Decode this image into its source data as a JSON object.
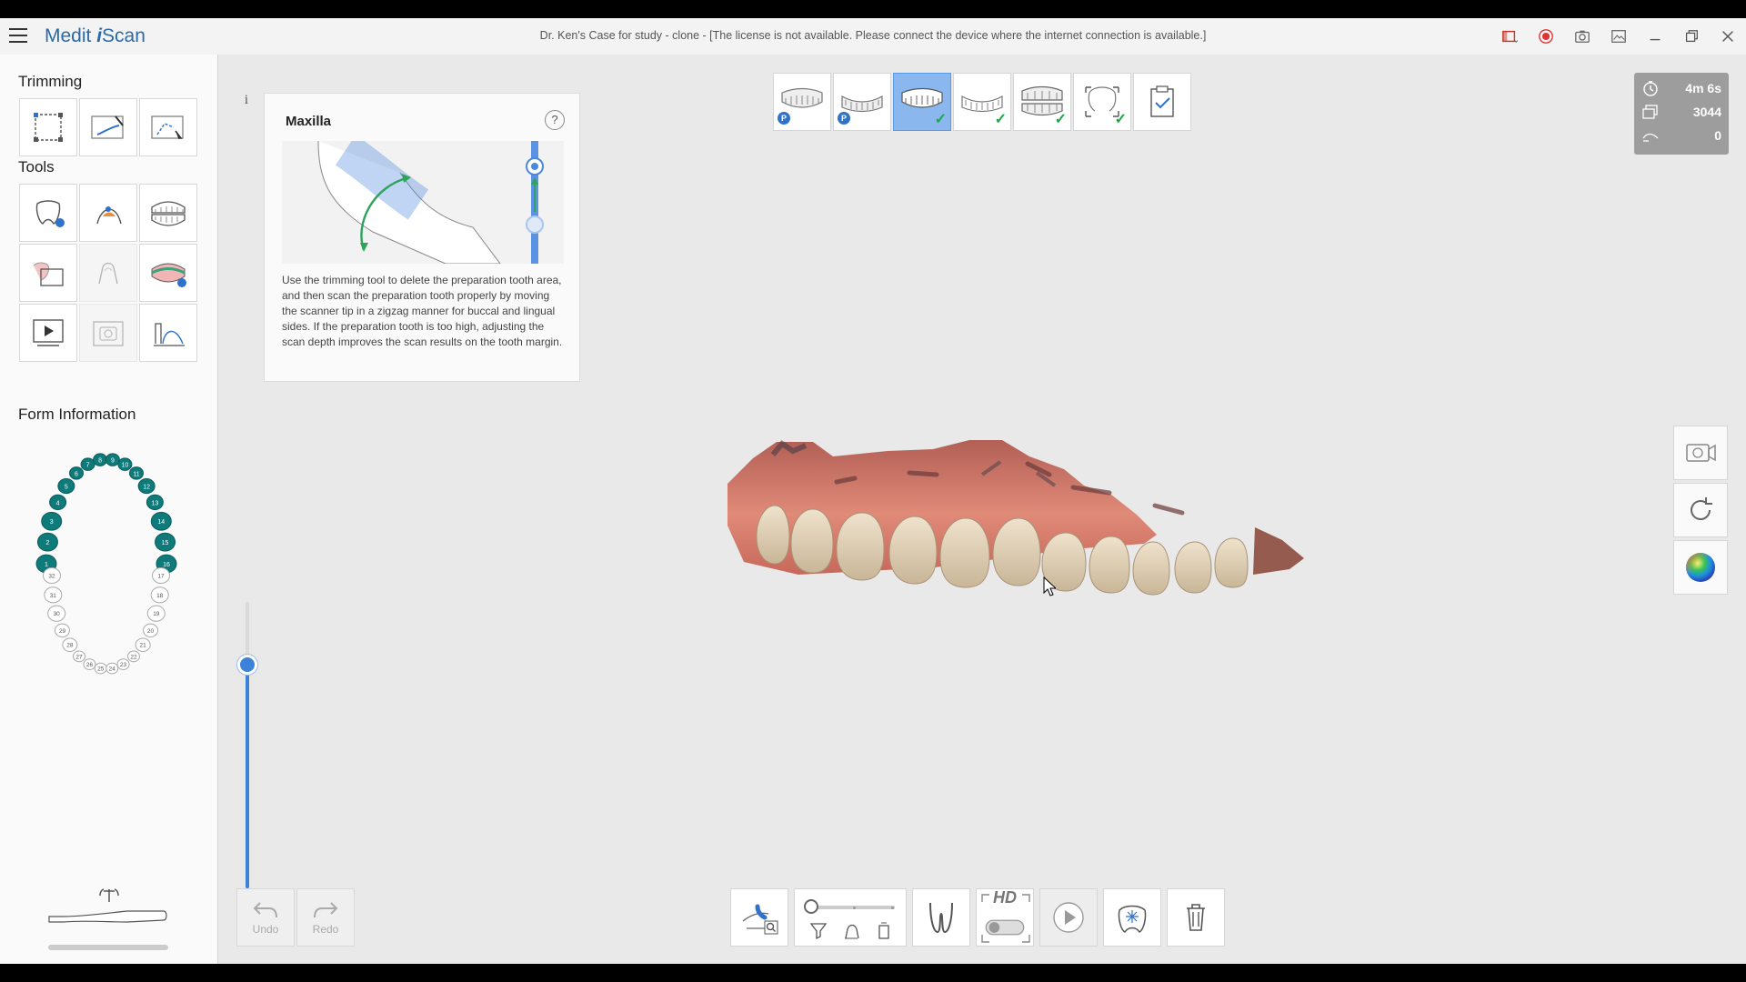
{
  "app": {
    "brand_left": "Medit",
    "brand_italic": "i",
    "brand_right": "Scan",
    "window_title": "Dr. Ken's Case for study - clone - [The license is not available. Please connect the device where the internet connection is available.]"
  },
  "sidebar": {
    "trimming_title": "Trimming",
    "tools_title": "Tools",
    "form_info_title": "Form Information",
    "upper_teeth": [
      "1",
      "2",
      "3",
      "4",
      "5",
      "6",
      "7",
      "8",
      "9",
      "10",
      "11",
      "12",
      "13",
      "14",
      "15",
      "16"
    ],
    "lower_teeth": [
      "17",
      "18",
      "19",
      "20",
      "21",
      "22",
      "23",
      "24",
      "25",
      "26",
      "27",
      "28",
      "29",
      "30",
      "31",
      "32"
    ]
  },
  "guide": {
    "title": "Maxilla",
    "help": "?",
    "info": "i",
    "text": "Use the trimming tool to delete the preparation tooth area, and then scan the preparation tooth properly by moving the scanner tip in a zigzag manner for buccal and lingual sides. If the preparation tooth is too high, adjusting the scan depth improves the scan results on the tooth margin."
  },
  "stats": {
    "time": "4m 6s",
    "frames": "3044",
    "value3": "0"
  },
  "scan_depth_level": 0.78,
  "undo": {
    "label": "Undo"
  },
  "redo": {
    "label": "Redo"
  },
  "bottom": {
    "hd_label": "HD"
  },
  "colors": {
    "accent": "#3b82d8",
    "teeth": "#0e7a7a",
    "check": "#22a44d"
  }
}
